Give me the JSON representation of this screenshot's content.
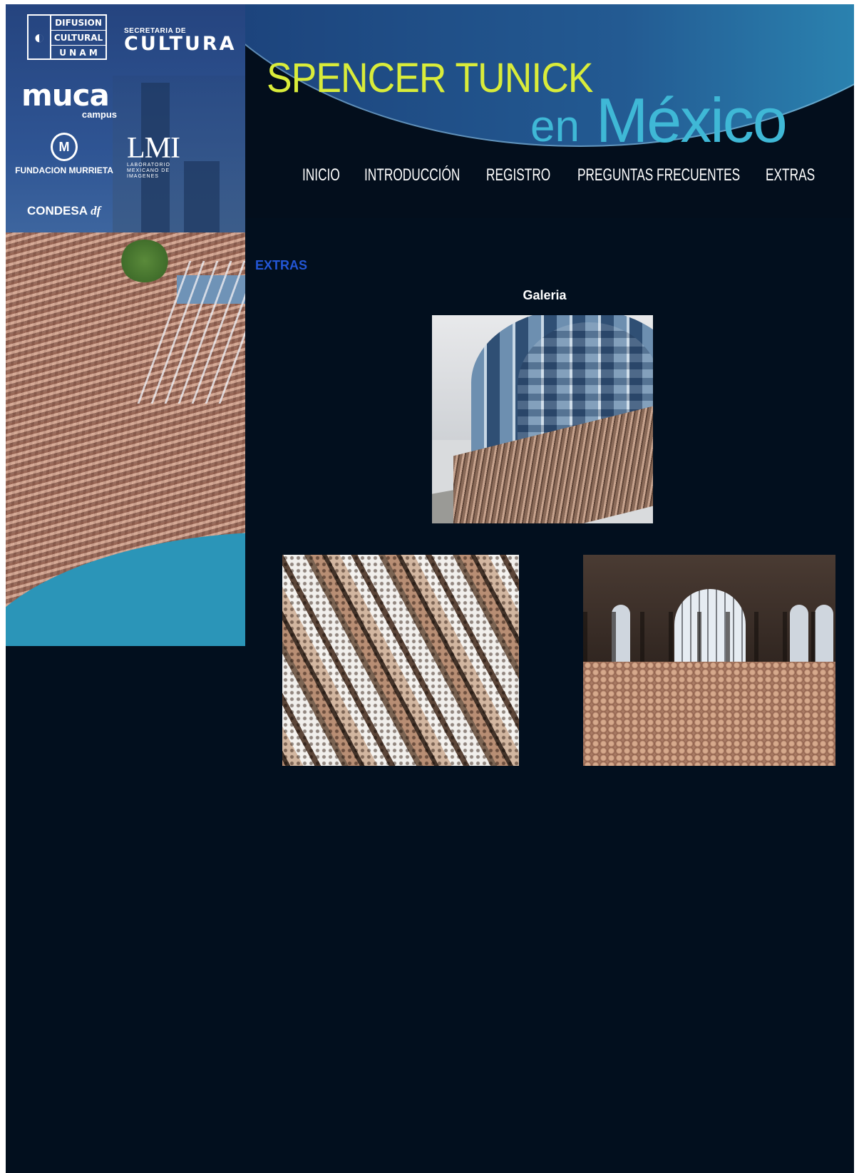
{
  "sponsors": {
    "unam": [
      "DIFUSION",
      "CULTURAL",
      "U N A M"
    ],
    "cultura_top": "SECRETARIA DE",
    "cultura_main": "CULTURA",
    "muca_main": "muca",
    "muca_sub": "campus",
    "murrieta": "FUNDACION MURRIETA",
    "lmi_main": "LMI",
    "lmi_sub": "LABORATORIO MEXICANO DE IMAGENES",
    "condesa": "CONDESA",
    "condesa_df": "df"
  },
  "header": {
    "title_line1": "SPENCER TUNICK",
    "title_en": "en",
    "title_mexico": "México"
  },
  "nav": {
    "items": [
      "INICIO",
      "INTRODUCCIÓN",
      "REGISTRO",
      "PREGUNTAS FRECUENTES",
      "EXTRAS"
    ]
  },
  "content": {
    "section_title": "EXTRAS",
    "gallery_title": "Galeria"
  },
  "colors": {
    "background": "#020f1e",
    "title_green": "#d9ec3a",
    "title_cyan": "#3fb8d6",
    "section_blue": "#2356d6"
  }
}
